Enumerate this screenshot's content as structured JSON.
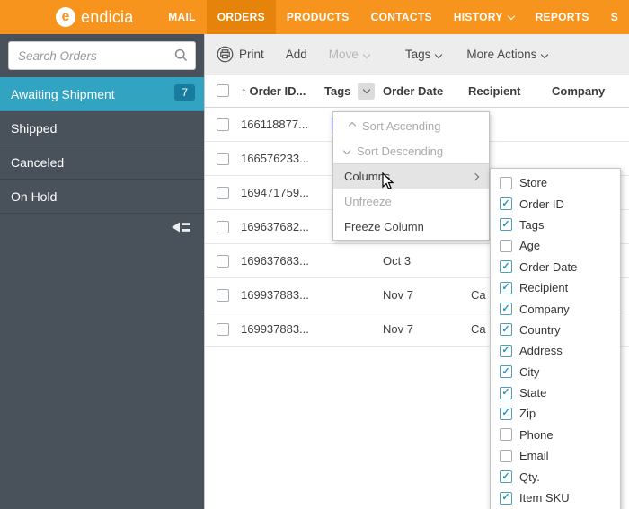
{
  "topbar": {
    "brand": "endicia",
    "nav": [
      {
        "label": "MAIL"
      },
      {
        "label": "ORDERS"
      },
      {
        "label": "PRODUCTS"
      },
      {
        "label": "CONTACTS"
      },
      {
        "label": "HISTORY"
      },
      {
        "label": "REPORTS"
      },
      {
        "label": "S"
      }
    ]
  },
  "sidebar": {
    "search_placeholder": "Search Orders",
    "items": [
      {
        "label": "Awaiting Shipment",
        "badge": "7",
        "active": true
      },
      {
        "label": "Shipped",
        "active": false
      },
      {
        "label": "Canceled",
        "active": false
      },
      {
        "label": "On Hold",
        "active": false
      }
    ]
  },
  "toolbar": {
    "print_label": "Print",
    "add_label": "Add",
    "move_label": "Move",
    "tags_label": "Tags",
    "more_actions_label": "More Actions"
  },
  "table": {
    "sort_icon": "↑",
    "headers": {
      "order_id": "Order ID...",
      "tags": "Tags",
      "order_date": "Order Date",
      "recipient": "Recipient",
      "company": "Company"
    },
    "rows": [
      {
        "order_id": "166118877...",
        "has_tag": true,
        "order_date": "",
        "recipient": ""
      },
      {
        "order_id": "166576233...",
        "has_tag": false,
        "order_date": "",
        "recipient": ""
      },
      {
        "order_id": "169471759...",
        "has_tag": false,
        "order_date": "",
        "recipient": ""
      },
      {
        "order_id": "169637682...",
        "has_tag": false,
        "order_date": "",
        "recipient": ""
      },
      {
        "order_id": "169637683...",
        "has_tag": false,
        "order_date": "Oct 3",
        "recipient": ""
      },
      {
        "order_id": "169937883...",
        "has_tag": false,
        "order_date": "Nov 7",
        "recipient": "Ca"
      },
      {
        "order_id": "169937883...",
        "has_tag": false,
        "order_date": "Nov 7",
        "recipient": "Ca"
      }
    ]
  },
  "column_menu": {
    "sort_ascending": "Sort Ascending",
    "sort_descending": "Sort Descending",
    "columns": "Columns",
    "unfreeze": "Unfreeze",
    "freeze_column": "Freeze Column"
  },
  "columns_submenu": [
    {
      "label": "Store",
      "checked": false
    },
    {
      "label": "Order ID",
      "checked": true
    },
    {
      "label": "Tags",
      "checked": true
    },
    {
      "label": "Age",
      "checked": false
    },
    {
      "label": "Order Date",
      "checked": true
    },
    {
      "label": "Recipient",
      "checked": true
    },
    {
      "label": "Company",
      "checked": true
    },
    {
      "label": "Country",
      "checked": true
    },
    {
      "label": "Address",
      "checked": true
    },
    {
      "label": "City",
      "checked": true
    },
    {
      "label": "State",
      "checked": true
    },
    {
      "label": "Zip",
      "checked": true
    },
    {
      "label": "Phone",
      "checked": false
    },
    {
      "label": "Email",
      "checked": false
    },
    {
      "label": "Qty.",
      "checked": true
    },
    {
      "label": "Item SKU",
      "checked": true
    }
  ],
  "icons": {
    "logo": "endicia-logo",
    "search": "magnifier",
    "print": "printer",
    "collapse": "collapse-sidebar-arrow",
    "sort": "arrow-up",
    "check": "✓"
  },
  "colors": {
    "brand_orange": "#F7941D",
    "active_tab_orange": "#E5830A",
    "sidebar_bg": "#49525A",
    "selected_teal": "#33A3C2",
    "badge_teal": "#187C9E",
    "tag_blue": "#3C42D8",
    "check_teal": "#2E93B8"
  }
}
